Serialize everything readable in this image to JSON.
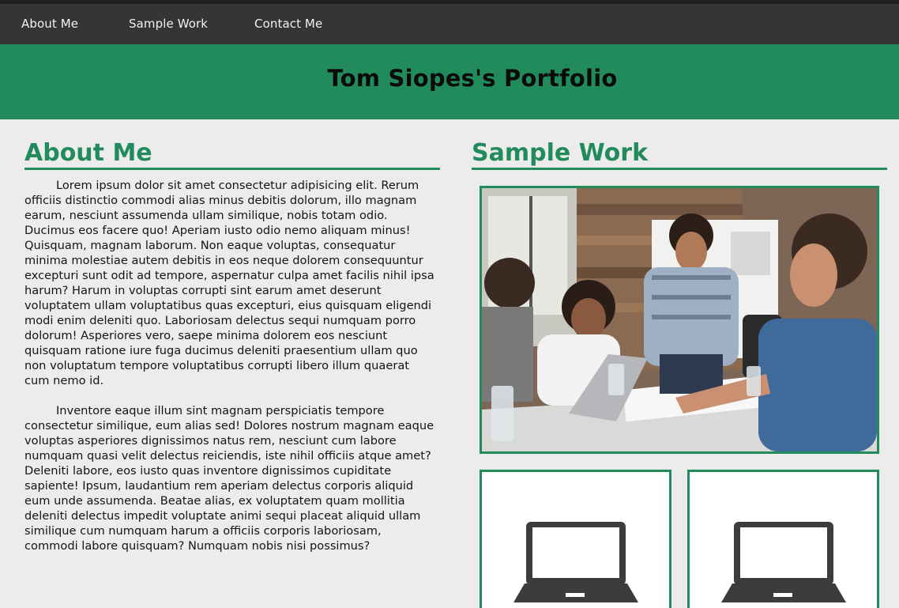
{
  "nav": {
    "items": [
      {
        "label": "About Me"
      },
      {
        "label": "Sample Work"
      },
      {
        "label": "Contact Me"
      }
    ]
  },
  "header": {
    "title": "Tom Siopes's Portfolio"
  },
  "about": {
    "heading": "About Me",
    "paragraphs": [
      "Lorem ipsum dolor sit amet consectetur adipisicing elit. Rerum officiis distinctio commodi alias minus debitis dolorum, illo magnam earum, nesciunt assumenda ullam similique, nobis totam odio. Ducimus eos facere quo! Aperiam iusto odio nemo aliquam minus! Quisquam, magnam laborum. Non eaque voluptas, consequatur minima molestiae autem debitis in eos neque dolorem consequuntur excepturi sunt odit ad tempore, aspernatur culpa amet facilis nihil ipsa harum? Harum in voluptas corrupti sint earum amet deserunt voluptatem ullam voluptatibus quas excepturi, eius quisquam eligendi modi enim deleniti quo. Laboriosam delectus sequi numquam porro dolorum! Asperiores vero, saepe minima dolorem eos nesciunt quisquam ratione iure fuga ducimus deleniti praesentium ullam quo non voluptatum tempore voluptatibus corrupti libero illum quaerat cum nemo id.",
      "Inventore eaque illum sint magnam perspiciatis tempore consectetur similique, eum alias sed! Dolores nostrum magnam eaque voluptas asperiores dignissimos natus rem, nesciunt cum labore numquam quasi velit delectus reiciendis, iste nihil officiis atque amet? Deleniti labore, eos iusto quas inventore dignissimos cupiditate sapiente! Ipsum, laudantium rem aperiam delectus corporis aliquid eum unde assumenda. Beatae alias, ex voluptatem quam mollitia deleniti delectus impedit voluptate animi sequi placeat aliquid ullam similique cum numquam harum a officiis corporis laboriosam, commodi labore quisquam? Numquam nobis nisi possimus?"
    ]
  },
  "work": {
    "heading": "Sample Work",
    "cards": [
      {
        "icon": "laptop-icon"
      },
      {
        "icon": "laptop-icon"
      }
    ]
  },
  "colors": {
    "accent": "#228b5c",
    "nav_bg": "#353535",
    "page_bg": "#ececec"
  }
}
